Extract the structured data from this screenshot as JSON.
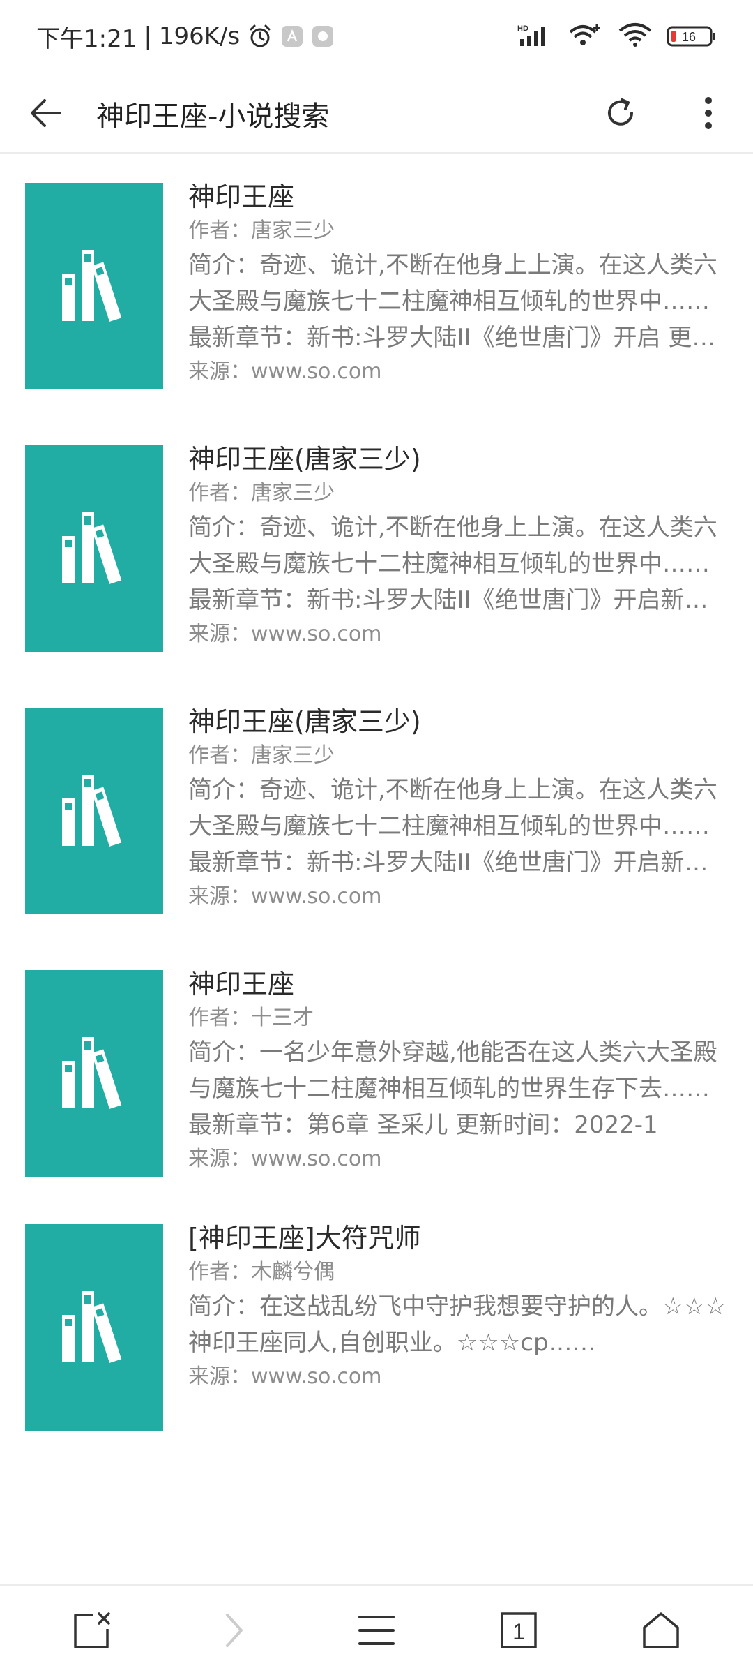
{
  "status_bar": {
    "time": "下午1:21",
    "speed": "196K/s",
    "battery": "16",
    "icons": [
      "alarm-icon",
      "app-notification-icon",
      "app-notification-icon-2",
      "hd-signal-icon",
      "wifi-plus-icon",
      "wifi-icon",
      "battery-icon"
    ]
  },
  "header": {
    "title": "神印王座-小说搜索",
    "back_icon": "arrow-left-icon",
    "refresh_icon": "refresh-icon",
    "more_icon": "more-vertical-icon"
  },
  "results": [
    {
      "title": "神印王座",
      "author": "作者：唐家三少",
      "intro": "简介：奇迹、诡计,不断在他身上上演。在这人类六大圣殿与魔族七十二柱魔神相互倾轧的世界中……",
      "latest": "最新章节：新书:斗罗大陆II《绝世唐门》开启 更新时间：",
      "source": "来源：www.so.com"
    },
    {
      "title": "神印王座(唐家三少)",
      "author": "作者：唐家三少",
      "intro": "简介：奇迹、诡计,不断在他身上上演。在这人类六大圣殿与魔族七十二柱魔神相互倾轧的世界中……",
      "latest": "最新章节：新书:斗罗大陆II《绝世唐门》开启新篇章",
      "source": "来源：www.so.com"
    },
    {
      "title": "神印王座(唐家三少)",
      "author": "作者：唐家三少",
      "intro": "简介：奇迹、诡计,不断在他身上上演。在这人类六大圣殿与魔族七十二柱魔神相互倾轧的世界中……",
      "latest": "最新章节：新书:斗罗大陆II《绝世唐门》开启新篇章",
      "source": "来源：www.so.com"
    },
    {
      "title": "神印王座",
      "author": "作者：十三才",
      "intro": "简介：一名少年意外穿越,他能否在这人类六大圣殿与魔族七十二柱魔神相互倾轧的世界生存下去……",
      "latest": "最新章节：第6章 圣采儿 更新时间：2022-1",
      "source": "来源：www.so.com"
    },
    {
      "title": "[神印王座]大符咒师",
      "author": "作者：木麟兮偶",
      "intro": "简介：在这战乱纷飞中守护我想要守护的人。☆☆☆神印王座同人,自创职业。☆☆☆cp……",
      "latest": "",
      "source": "来源：www.so.com"
    }
  ],
  "cover_icon": "book-stack-icon",
  "colors": {
    "cover_bg": "#22ada4",
    "text_primary": "#2a2a2a",
    "text_secondary": "#7a7a7a"
  },
  "bottom_nav": {
    "icons": [
      "close-page-icon",
      "forward-icon",
      "menu-icon",
      "tabs-icon",
      "home-icon"
    ],
    "tab_count": "1"
  }
}
